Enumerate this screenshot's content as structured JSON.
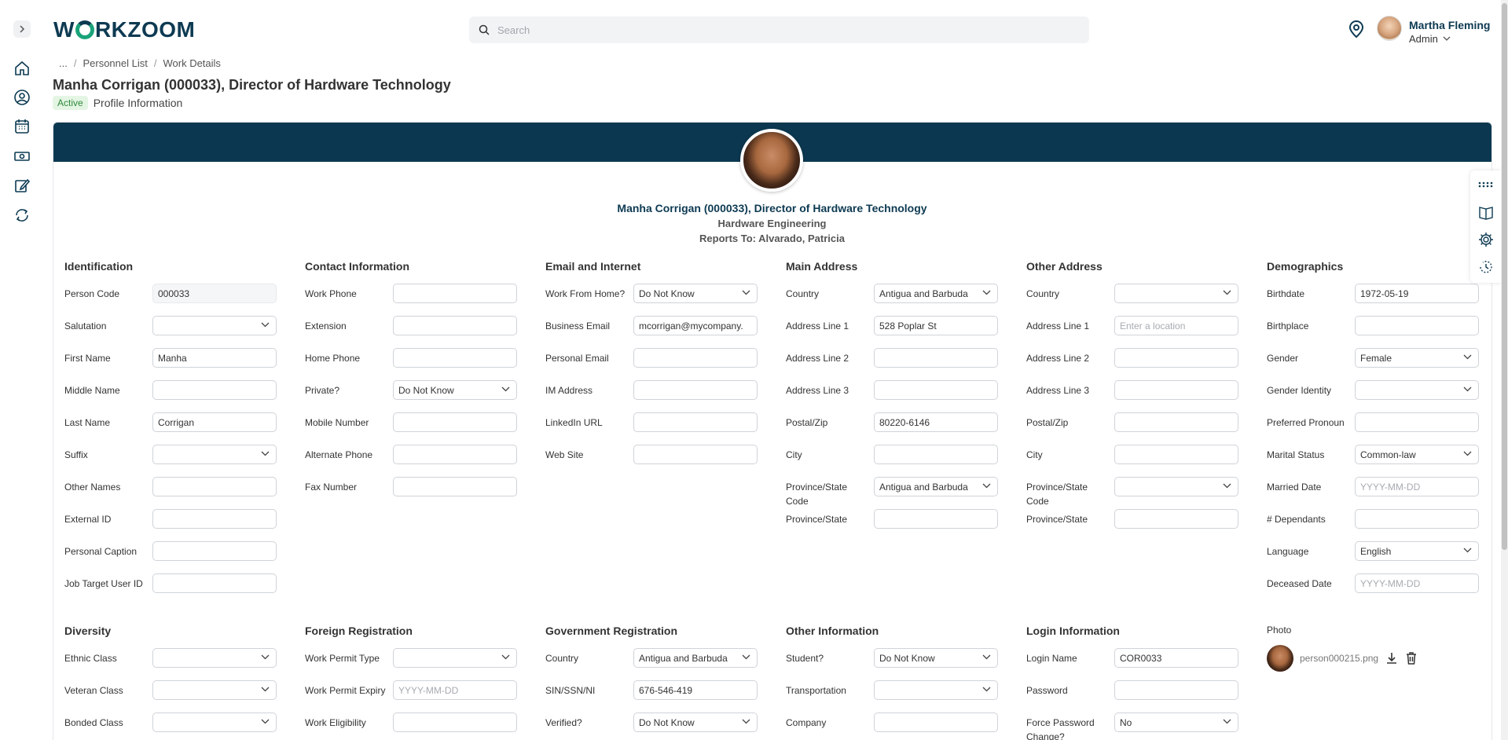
{
  "header": {
    "logo": "WORKZOOM",
    "search_placeholder": "Search",
    "user_name": "Martha Fleming",
    "user_role": "Admin"
  },
  "breadcrumb": {
    "ellipsis": "...",
    "items": [
      "Personnel List",
      "Work Details"
    ]
  },
  "page": {
    "title": "Manha Corrigan (000033), Director of Hardware Technology",
    "status": "Active",
    "subtitle": "Profile Information"
  },
  "profile": {
    "name": "Manha Corrigan (000033), Director of Hardware Technology",
    "department": "Hardware Engineering",
    "reports_to": "Reports To: Alvarado, Patricia"
  },
  "sections": {
    "identification": {
      "title": "Identification",
      "fields": [
        {
          "label": "Person Code",
          "value": "000033"
        },
        {
          "label": "Salutation",
          "value": ""
        },
        {
          "label": "First Name",
          "value": "Manha"
        },
        {
          "label": "Middle Name",
          "value": ""
        },
        {
          "label": "Last Name",
          "value": "Corrigan"
        },
        {
          "label": "Suffix",
          "value": ""
        },
        {
          "label": "Other Names",
          "value": ""
        },
        {
          "label": "External ID",
          "value": ""
        },
        {
          "label": "Personal Caption",
          "value": ""
        },
        {
          "label": "Job Target User ID",
          "value": ""
        }
      ]
    },
    "contact": {
      "title": "Contact Information",
      "fields": [
        {
          "label": "Work Phone",
          "value": ""
        },
        {
          "label": "Extension",
          "value": ""
        },
        {
          "label": "Home Phone",
          "value": ""
        },
        {
          "label": "Private?",
          "value": "Do Not Know"
        },
        {
          "label": "Mobile Number",
          "value": ""
        },
        {
          "label": "Alternate Phone",
          "value": ""
        },
        {
          "label": "Fax Number",
          "value": ""
        }
      ]
    },
    "email": {
      "title": "Email and Internet",
      "fields": [
        {
          "label": "Work From Home?",
          "value": "Do Not Know"
        },
        {
          "label": "Business Email",
          "value": "mcorrigan@mycompany.com"
        },
        {
          "label": "Personal Email",
          "value": ""
        },
        {
          "label": "IM Address",
          "value": ""
        },
        {
          "label": "LinkedIn URL",
          "value": ""
        },
        {
          "label": "Web Site",
          "value": ""
        }
      ]
    },
    "main_address": {
      "title": "Main Address",
      "fields": [
        {
          "label": "Country",
          "value": "Antigua and Barbuda"
        },
        {
          "label": "Address Line 1",
          "value": "528 Poplar St"
        },
        {
          "label": "Address Line 2",
          "value": ""
        },
        {
          "label": "Address Line 3",
          "value": ""
        },
        {
          "label": "Postal/Zip",
          "value": "80220-6146"
        },
        {
          "label": "City",
          "value": ""
        },
        {
          "label": "Province/State Code",
          "value": "Antigua and Barbuda"
        },
        {
          "label": "Province/State",
          "value": ""
        }
      ]
    },
    "other_address": {
      "title": "Other Address",
      "fields": [
        {
          "label": "Country",
          "value": ""
        },
        {
          "label": "Address Line 1",
          "placeholder": "Enter a location"
        },
        {
          "label": "Address Line 2",
          "value": ""
        },
        {
          "label": "Address Line 3",
          "value": ""
        },
        {
          "label": "Postal/Zip",
          "value": ""
        },
        {
          "label": "City",
          "value": ""
        },
        {
          "label": "Province/State Code",
          "value": ""
        },
        {
          "label": "Province/State",
          "value": ""
        }
      ]
    },
    "demographics": {
      "title": "Demographics",
      "fields": [
        {
          "label": "Birthdate",
          "value": "1972-05-19"
        },
        {
          "label": "Birthplace",
          "value": ""
        },
        {
          "label": "Gender",
          "value": "Female"
        },
        {
          "label": "Gender Identity",
          "value": ""
        },
        {
          "label": "Preferred Pronoun",
          "value": ""
        },
        {
          "label": "Marital Status",
          "value": "Common-law"
        },
        {
          "label": "Married Date",
          "placeholder": "YYYY-MM-DD"
        },
        {
          "label": "# Dependants",
          "value": ""
        },
        {
          "label": "Language",
          "value": "English"
        },
        {
          "label": "Deceased Date",
          "placeholder": "YYYY-MM-DD"
        }
      ]
    },
    "diversity": {
      "title": "Diversity",
      "fields": [
        {
          "label": "Ethnic Class",
          "value": ""
        },
        {
          "label": "Veteran Class",
          "value": ""
        },
        {
          "label": "Bonded Class",
          "value": ""
        }
      ]
    },
    "foreign": {
      "title": "Foreign Registration",
      "fields": [
        {
          "label": "Work Permit Type",
          "value": ""
        },
        {
          "label": "Work Permit Expiry",
          "placeholder": "YYYY-MM-DD"
        },
        {
          "label": "Work Eligibility",
          "value": ""
        }
      ]
    },
    "government": {
      "title": "Government Registration",
      "fields": [
        {
          "label": "Country",
          "value": "Antigua and Barbuda"
        },
        {
          "label": "SIN/SSN/NI",
          "value": "676-546-419"
        },
        {
          "label": "Verified?",
          "value": "Do Not Know"
        }
      ]
    },
    "other_info": {
      "title": "Other Information",
      "fields": [
        {
          "label": "Student?",
          "value": "Do Not Know"
        },
        {
          "label": "Transportation",
          "value": ""
        },
        {
          "label": "Company",
          "value": ""
        }
      ]
    },
    "login": {
      "title": "Login Information",
      "fields": [
        {
          "label": "Login Name",
          "value": "COR0033"
        },
        {
          "label": "Password",
          "value": ""
        },
        {
          "label": "Force Password Change?",
          "value": "No"
        }
      ]
    },
    "photo": {
      "title": "Photo",
      "filename": "person000215.png"
    }
  }
}
